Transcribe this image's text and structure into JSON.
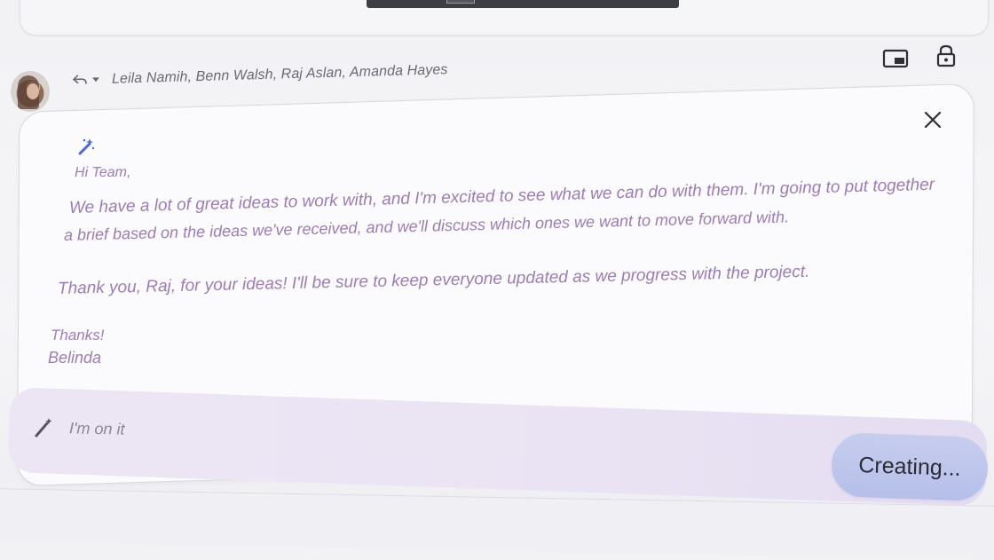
{
  "header": {
    "recipients": "Leila Namih, Benn Walsh, Raj Aslan, Amanda Hayes",
    "reply_icon": "reply-icon",
    "caret_icon": "caret-down-icon",
    "pip_icon": "picture-in-picture-icon",
    "lock_icon": "lock-icon"
  },
  "compose": {
    "close_icon": "close-icon",
    "magic_icon": "magic-wand-icon",
    "greeting": "Hi Team,",
    "body_line1": "We have a lot of great ideas to work with, and I'm excited to see what we can do with them. I'm going to put together",
    "body_line2": "a brief based on the ideas we've received, and we'll discuss which ones we want to move forward with.",
    "thanks_line": "Thank you, Raj, for your ideas! I'll be sure to keep everyone updated as we progress with the project.",
    "signoff": "Thanks!",
    "signature": "Belinda"
  },
  "prompt": {
    "pencil_icon": "pencil-icon",
    "text": "I'm on it",
    "status_button": "Creating..."
  },
  "colors": {
    "text_generated": "#9c7cb4",
    "prompt_bar": "#ebe5f4",
    "button": "#bcc4ec"
  }
}
